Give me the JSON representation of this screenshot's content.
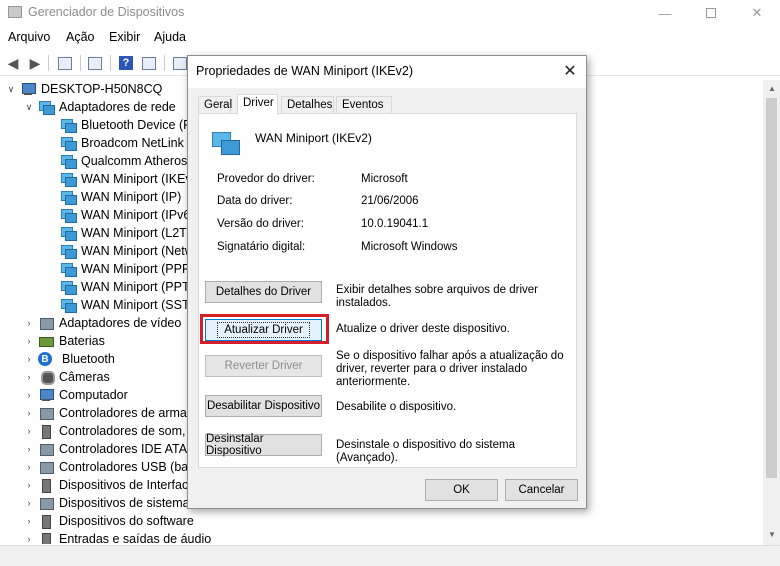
{
  "window": {
    "title": "Gerenciador de Dispositivos"
  },
  "menu": [
    "Arquivo",
    "Ação",
    "Exibir",
    "Ajuda"
  ],
  "tree": {
    "root": "DESKTOP-H50N8CQ",
    "network_category": "Adaptadores de rede",
    "network_items": [
      "Bluetooth Device (Pe",
      "Broadcom NetLink (",
      "Qualcomm Atheros",
      "WAN Miniport (IKEv",
      "WAN Miniport (IP)",
      "WAN Miniport (IPv6",
      "WAN Miniport (L2TP",
      "WAN Miniport (Netw",
      "WAN Miniport (PPPO",
      "WAN Miniport (PPTF",
      "WAN Miniport (SSTP"
    ],
    "categories": [
      {
        "label": "Adaptadores de vídeo",
        "icon": "display-icon"
      },
      {
        "label": "Baterias",
        "icon": "battery-icon"
      },
      {
        "label": "Bluetooth",
        "icon": "bluetooth-icon"
      },
      {
        "label": "Câmeras",
        "icon": "camera-icon"
      },
      {
        "label": "Computador",
        "icon": "computer-icon"
      },
      {
        "label": "Controladores de armaz",
        "icon": "storage-controller-icon"
      },
      {
        "label": "Controladores de som, v",
        "icon": "sound-icon"
      },
      {
        "label": "Controladores IDE ATA/",
        "icon": "ide-controller-icon"
      },
      {
        "label": "Controladores USB (bar",
        "icon": "usb-icon"
      },
      {
        "label": "Dispositivos de Interface",
        "icon": "hid-icon"
      },
      {
        "label": "Dispositivos de sistema",
        "icon": "system-device-icon"
      },
      {
        "label": "Dispositivos do software",
        "icon": "software-device-icon"
      },
      {
        "label": "Entradas e saídas de áudio",
        "icon": "audio-io-icon"
      }
    ]
  },
  "dialog": {
    "title": "Propriedades de WAN Miniport (IKEv2)",
    "tabs": [
      "Geral",
      "Driver",
      "Detalhes",
      "Eventos"
    ],
    "active_tab": "Driver",
    "device_name": "WAN Miniport (IKEv2)",
    "properties": [
      {
        "label": "Provedor do driver:",
        "value": "Microsoft"
      },
      {
        "label": "Data do driver:",
        "value": "21/06/2006"
      },
      {
        "label": "Versão do driver:",
        "value": "10.0.19041.1"
      },
      {
        "label": "Signatário digital:",
        "value": "Microsoft Windows"
      }
    ],
    "actions": [
      {
        "button": "Detalhes do Driver",
        "desc": "Exibir detalhes sobre arquivos de driver instalados.",
        "enabled": true
      },
      {
        "button": "Atualizar Driver",
        "desc": "Atualize o driver deste dispositivo.",
        "enabled": true
      },
      {
        "button": "Reverter Driver",
        "desc": "Se o dispositivo falhar após a atualização do driver, reverter para o driver instalado anteriormente.",
        "enabled": false
      },
      {
        "button": "Desabilitar Dispositivo",
        "desc": "Desabilite o dispositivo.",
        "enabled": true
      },
      {
        "button": "Desinstalar Dispositivo",
        "desc": "Desinstale o dispositivo do sistema (Avançado).",
        "enabled": true
      }
    ],
    "ok_label": "OK",
    "cancel_label": "Cancelar"
  },
  "colors": {
    "highlight": "#d31f2b",
    "focus": "#0078d7"
  }
}
